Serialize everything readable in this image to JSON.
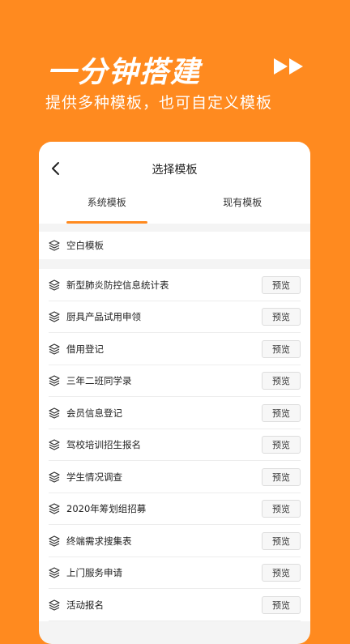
{
  "hero": {
    "title": "一分钟搭建",
    "subtitle": "提供多种模板，也可自定义模板"
  },
  "nav": {
    "title": "选择模板"
  },
  "tabs": [
    {
      "label": "系统模板",
      "active": true
    },
    {
      "label": "现有模板",
      "active": false
    }
  ],
  "blank_template": {
    "label": "空白模板"
  },
  "preview_label": "预览",
  "templates": [
    "新型肺炎防控信息统计表",
    "厨具产品试用申领",
    "借用登记",
    "三年二班同学录",
    "会员信息登记",
    "驾校培训招生报名",
    "学生情况调查",
    "2020年筹划组招募",
    "终端需求搜集表",
    "上门服务申请",
    "活动报名"
  ],
  "colors": {
    "accent": "#FF8A1F",
    "background": "#F4F4F4"
  },
  "icons": {
    "back": "chevron-left-icon",
    "layer": "layers-icon",
    "forward": "fast-forward-icon"
  }
}
